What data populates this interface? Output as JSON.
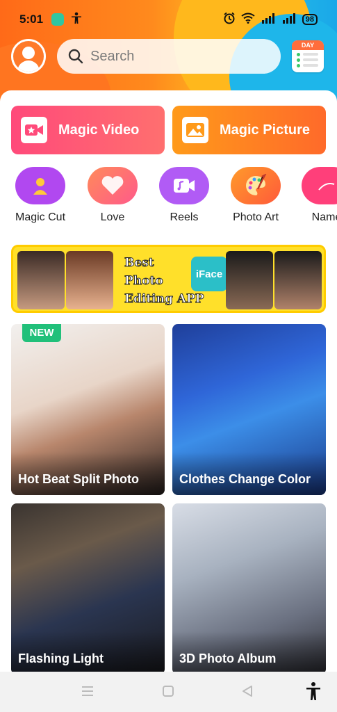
{
  "status_bar": {
    "time": "5:01",
    "battery": "98"
  },
  "search": {
    "placeholder": "Search"
  },
  "calendar": {
    "label": "DAY"
  },
  "quick_actions": [
    {
      "label": "Magic Video",
      "icon": "video-star-icon"
    },
    {
      "label": "Magic Picture",
      "icon": "image-icon"
    }
  ],
  "shortcuts": [
    {
      "label": "Magic Cut",
      "icon": "person-cut-icon",
      "color": "#b148f0"
    },
    {
      "label": "Love",
      "icon": "heart-icon",
      "color": "#ff7a7a"
    },
    {
      "label": "Reels",
      "icon": "reels-icon",
      "color": "#b15bf5"
    },
    {
      "label": "Photo Art",
      "icon": "palette-icon",
      "color": "#ff7b2a"
    },
    {
      "label": "Name",
      "icon": "name-icon",
      "color": "#ff3f7a"
    }
  ],
  "banner": {
    "line1": "Best",
    "line2": "Photo",
    "line3": "Editing APP",
    "app_name": "iFace"
  },
  "cards": [
    {
      "title": "Hot Beat Split Photo",
      "badge": "NEW"
    },
    {
      "title": "Clothes Change Color"
    },
    {
      "title": "Flashing Light"
    },
    {
      "title": "3D Photo Album"
    }
  ]
}
